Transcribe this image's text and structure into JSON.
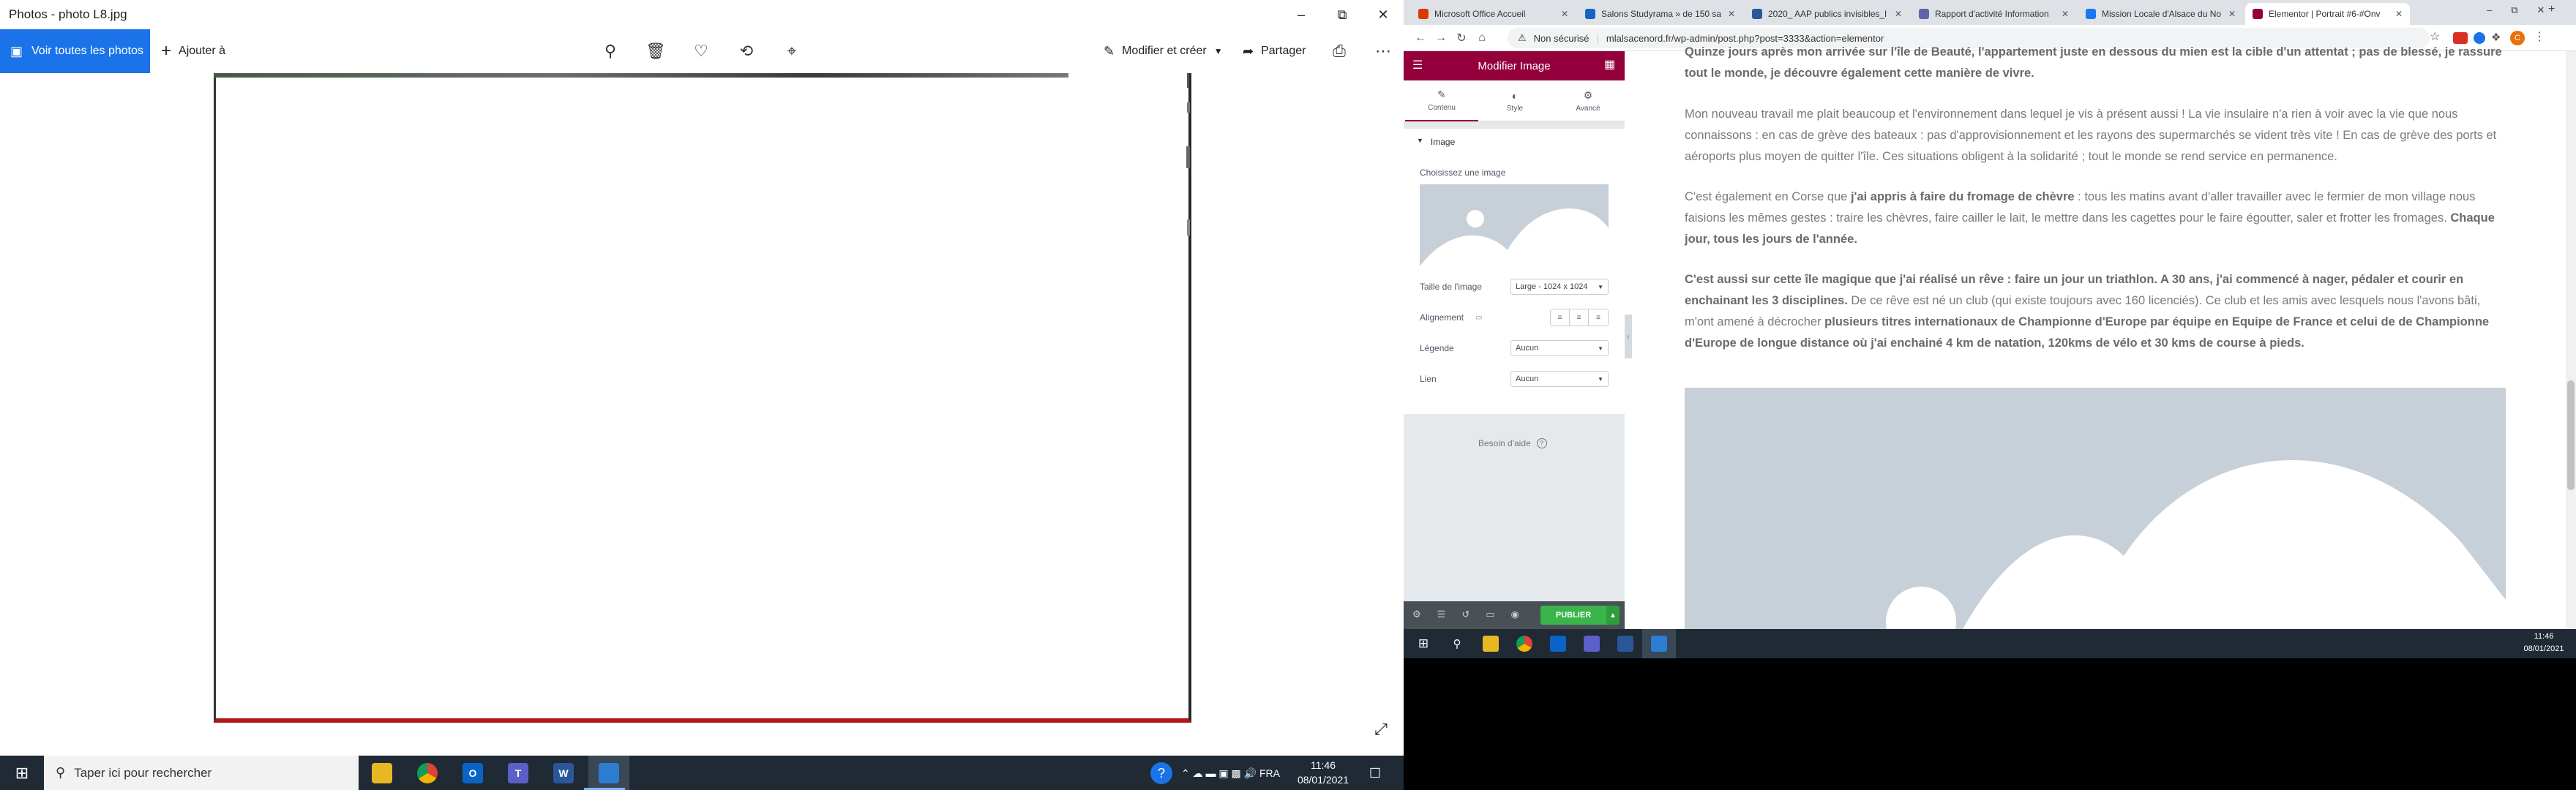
{
  "photos": {
    "window_title": "Photos - photo L8.jpg",
    "see_all_label": "Voir toutes les photos",
    "add_to_label": "Ajouter à",
    "edit_create_label": "Modifier et créer",
    "share_label": "Partager"
  },
  "taskbar_left": {
    "search_placeholder": "Taper ici pour rechercher",
    "time": "11:46",
    "date": "08/01/2021"
  },
  "browser": {
    "tabs": [
      {
        "title": "Microsoft Office Accueil",
        "color": "#d83b01"
      },
      {
        "title": "Salons Studyrama » de 150 sa",
        "color": "#1565c0"
      },
      {
        "title": "2020_ AAP publics invisibles_l",
        "color": "#2b579a"
      },
      {
        "title": "Rapport d'activité Information",
        "color": "#6264a7"
      },
      {
        "title": "Mission Locale d'Alsace du No",
        "color": "#1877f2"
      },
      {
        "title": "Elementor | Portrait #6-#Onv",
        "color": "#92003b"
      }
    ],
    "security_label": "Non sécurisé",
    "url": "mlalsacenord.fr/wp-admin/post.php?post=3333&action=elementor"
  },
  "elementor": {
    "header_title": "Modifier Image",
    "tabs": [
      "Contenu",
      "Style",
      "Avancé"
    ],
    "section_title": "Image",
    "choose_image_label": "Choisissez une image",
    "size_label": "Taille de l'image",
    "size_value": "Large - 1024 x 1024",
    "alignment_label": "Alignement",
    "caption_label": "Légende",
    "caption_value": "Aucun",
    "link_label": "Lien",
    "link_value": "Aucun",
    "help_label": "Besoin d'aide",
    "publish_label": "PUBLIER"
  },
  "content": {
    "p1": "Quinze jours après mon arrivée sur l'île de Beauté, l'appartement juste en dessous du mien est la cible d'un attentat ; pas de blessé, je rassure tout le monde, je découvre également cette manière de vivre.",
    "p2": "Mon nouveau travail me plait beaucoup et l'environnement dans lequel je vis à présent aussi ! La vie insulaire n'a rien à voir avec la vie que nous connaissons : en cas de grève des bateaux : pas d'approvisionnement et les rayons des supermarchés se vident très vite ! En cas de grève des ports et aéroports plus moyen de quitter l'île. Ces situations obligent à la solidarité ; tout le monde se rend service en permanence.",
    "p3_a": "C'est également en Corse que ",
    "p3_b": "j'ai appris à faire du fromage de chèvre",
    "p3_c": " : tous les matins avant d'aller travailler avec le fermier de mon village nous faisions les mêmes gestes : traire les chèvres, faire cailler le lait, le mettre dans les cagettes pour le faire égoutter, saler et frotter les fromages. ",
    "p3_d": "Chaque jour, tous les jours de l'année.",
    "p4_a": "C'est aussi sur cette île magique que j'ai réalisé un rêve : faire un jour un triathlon. A 30 ans, j'ai commencé à nager, pédaler et courir en enchainant les 3 disciplines.",
    "p4_b": " De ce rêve est né un club (qui existe toujours avec 160 licenciés). Ce club et les amis avec lesquels nous l'avons bâti, m'ont amené à décrocher ",
    "p4_c": "plusieurs titres internationaux de Championne d'Europe par équipe en Equipe de France et celui de de Championne d'Europe de longue distance où j'ai enchainé 4 km de natation, 120kms de vélo et 30 kms de course à pieds."
  },
  "taskbar_right": {
    "time": "11:46",
    "date": "08/01/2021"
  }
}
